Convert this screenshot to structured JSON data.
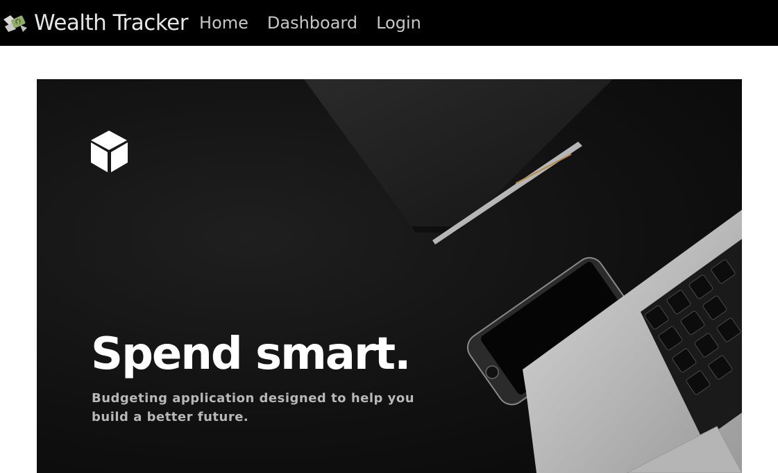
{
  "navbar": {
    "brand": {
      "logo_icon": "money-with-wings-icon",
      "title": "Wealth Tracker"
    },
    "links": [
      {
        "label": "Home"
      },
      {
        "label": "Dashboard"
      },
      {
        "label": "Login"
      }
    ]
  },
  "hero": {
    "logo_icon": "cube-icon",
    "headline": "Spend smart.",
    "subtitle": "Budgeting application designed to help you build a better future.",
    "background_image": "dark desk with notebook, pen, smartphone and laptop"
  },
  "colors": {
    "navbar_bg": "#000000",
    "nav_text": "#c7c7c7",
    "hero_bg": "#111111",
    "headline": "#ffffff",
    "subtitle": "#b8b8b8"
  }
}
